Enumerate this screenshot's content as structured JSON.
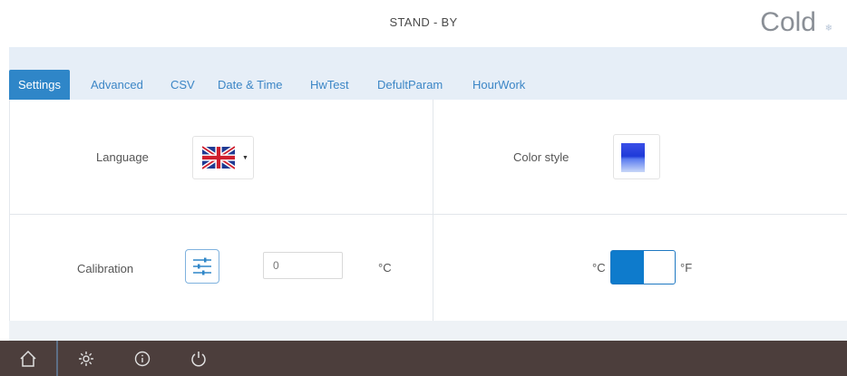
{
  "header": {
    "status": "STAND - BY",
    "mode": "Cold"
  },
  "tabs": [
    {
      "label": "Settings",
      "active": true
    },
    {
      "label": "Advanced"
    },
    {
      "label": "CSV"
    },
    {
      "label": "Date & Time"
    },
    {
      "label": "HwTest"
    },
    {
      "label": "DefultParam"
    },
    {
      "label": "HourWork"
    }
  ],
  "settings": {
    "language_label": "Language",
    "language_icon": "uk-flag-icon",
    "color_style_label": "Color style",
    "calibration_label": "Calibration",
    "calibration_value": "0",
    "calibration_unit": "°C",
    "unit_toggle_left": "°C",
    "unit_toggle_right": "°F",
    "unit_selected": "°C"
  },
  "colors": {
    "accent": "#2f86c8",
    "tab_bar": "#e6eef7",
    "navbar": "#4c3e3c",
    "toggle_active": "#0e7bcc"
  },
  "navbar": {
    "icons": [
      "home-icon",
      "gear-icon",
      "info-icon",
      "power-icon"
    ]
  }
}
